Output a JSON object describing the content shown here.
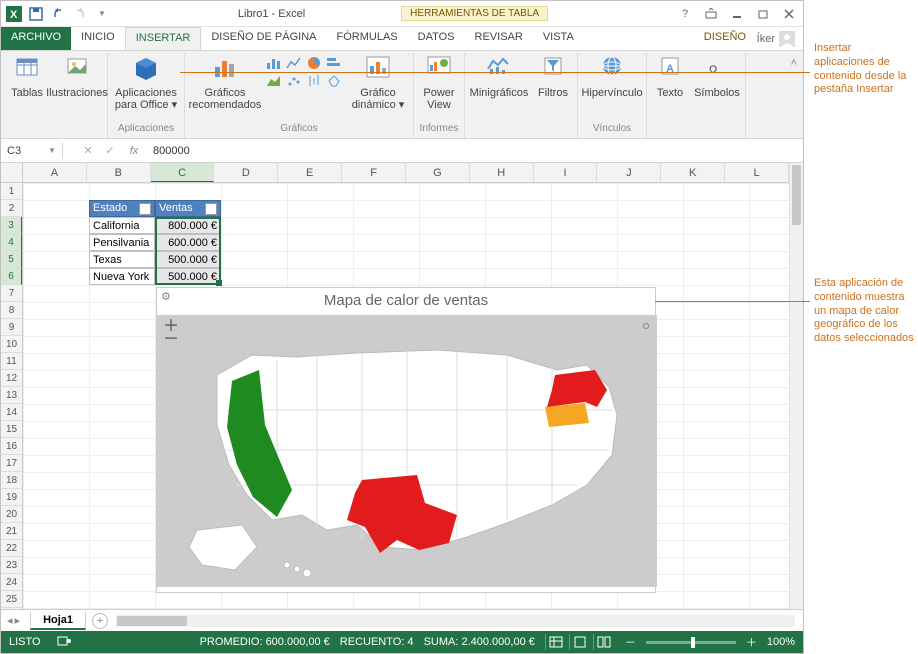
{
  "titlebar": {
    "title": "Libro1 - Excel",
    "tools_tab": "HERRAMIENTAS DE TABLA",
    "user": "Íker"
  },
  "tabs": {
    "archivo": "ARCHIVO",
    "inicio": "INICIO",
    "insertar": "INSERTAR",
    "diseno_pagina": "DISEÑO DE PÁGINA",
    "formulas": "FÓRMULAS",
    "datos": "DATOS",
    "revisar": "REVISAR",
    "vista": "VISTA",
    "diseno": "DISEÑO"
  },
  "ribbon": {
    "tablas": "Tablas",
    "ilustraciones": "Ilustraciones",
    "aplicaciones_office": "Aplicaciones para Office ▾",
    "aplicaciones_group": "Aplicaciones",
    "graficos_recom": "Gráficos recomendados",
    "graficos_group": "Gráficos",
    "grafico_dinamico": "Gráfico dinámico ▾",
    "power_view": "Power View",
    "informes_group": "Informes",
    "minigraficos": "Minigráficos",
    "filtros": "Filtros",
    "hipervinculo": "Hipervínculo",
    "vinculos_group": "Vínculos",
    "texto": "Texto",
    "simbolos": "Símbolos"
  },
  "formula_bar": {
    "name_box": "C3",
    "value": "800000"
  },
  "columns": [
    "A",
    "B",
    "C",
    "D",
    "E",
    "F",
    "G",
    "H",
    "I",
    "J",
    "K",
    "L"
  ],
  "table": {
    "headers": {
      "estado": "Estado",
      "ventas": "Ventas"
    },
    "rows": [
      {
        "estado": "California",
        "ventas": "800.000 €"
      },
      {
        "estado": "Pensilvania",
        "ventas": "600.000 €"
      },
      {
        "estado": "Texas",
        "ventas": "500.000 €"
      },
      {
        "estado": "Nueva York",
        "ventas": "500.000 €"
      }
    ]
  },
  "map_app": {
    "title": "Mapa de calor de ventas"
  },
  "chart_data": {
    "type": "map",
    "title": "Mapa de calor de ventas",
    "region": "USA",
    "metric": "Ventas (€)",
    "data": [
      {
        "state": "California",
        "value": 800000,
        "color": "#1f8a1f"
      },
      {
        "state": "Pensilvania",
        "value": 600000,
        "color": "#f5a623"
      },
      {
        "state": "Texas",
        "value": 500000,
        "color": "#e21c1c"
      },
      {
        "state": "Nueva York",
        "value": 500000,
        "color": "#e21c1c"
      }
    ]
  },
  "sheet_tabs": {
    "hoja1": "Hoja1"
  },
  "status": {
    "listo": "LISTO",
    "promedio": "PROMEDIO: 600.000,00 €",
    "recuento": "RECUENTO: 4",
    "suma": "SUMA: 2.400.000,00 €",
    "zoom": "100%"
  },
  "callouts": {
    "c1": "Insertar aplicaciones de contenido desde la pestaña Insertar",
    "c2": "Esta aplicación de contenido muestra un mapa de calor geográfico de los datos seleccionados"
  }
}
